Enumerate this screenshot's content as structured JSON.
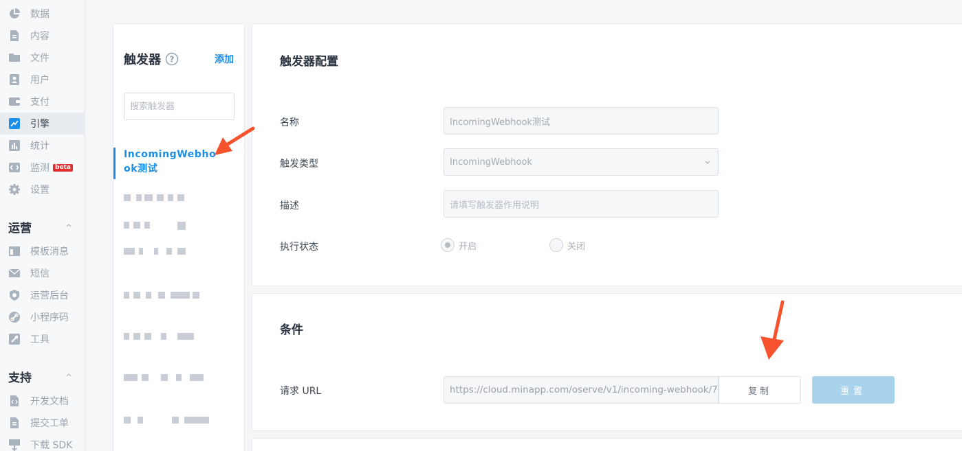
{
  "sidebar": {
    "items": [
      {
        "label": "数据",
        "icon": "pie-chart-icon"
      },
      {
        "label": "内容",
        "icon": "document-icon"
      },
      {
        "label": "文件",
        "icon": "folder-icon"
      },
      {
        "label": "用户",
        "icon": "user-icon"
      },
      {
        "label": "支付",
        "icon": "wallet-icon"
      },
      {
        "label": "引擎",
        "icon": "trend-icon",
        "active": true
      },
      {
        "label": "统计",
        "icon": "bar-chart-icon"
      },
      {
        "label": "监测",
        "icon": "code-icon",
        "badge": "beta"
      },
      {
        "label": "设置",
        "icon": "gear-icon"
      }
    ],
    "sections": [
      {
        "title": "运营",
        "items": [
          {
            "label": "模板消息",
            "icon": "template-icon"
          },
          {
            "label": "短信",
            "icon": "mail-icon"
          },
          {
            "label": "运营后台",
            "icon": "shield-icon"
          },
          {
            "label": "小程序码",
            "icon": "link-icon"
          },
          {
            "label": "工具",
            "icon": "wrench-icon"
          }
        ]
      },
      {
        "title": "支持",
        "items": [
          {
            "label": "开发文档",
            "icon": "code-doc-icon"
          },
          {
            "label": "提交工单",
            "icon": "ticket-icon"
          },
          {
            "label": "下载 SDK",
            "icon": "sdk-download-icon"
          }
        ]
      }
    ]
  },
  "triggers": {
    "title": "触发器",
    "add_label": "添加",
    "search_placeholder": "搜索触发器",
    "active_item": "IncomingWebhook测试"
  },
  "config": {
    "title": "触发器配置",
    "name_label": "名称",
    "name_value": "IncomingWebhook测试",
    "type_label": "触发类型",
    "type_value": "IncomingWebhook",
    "desc_label": "描述",
    "desc_placeholder": "请填写触发器作用说明",
    "status_label": "执行状态",
    "status_on": "开启",
    "status_off": "关闭"
  },
  "conditions": {
    "title": "条件",
    "url_label": "请求 URL",
    "url_value": "https://cloud.minapp.com/oserve/v1/incoming-webhook/7",
    "copy_label": "复制",
    "reset_label": "重置"
  },
  "colors": {
    "accent": "#1a8ee6",
    "arrow": "#f5522d",
    "beta": "#e02d2d"
  }
}
